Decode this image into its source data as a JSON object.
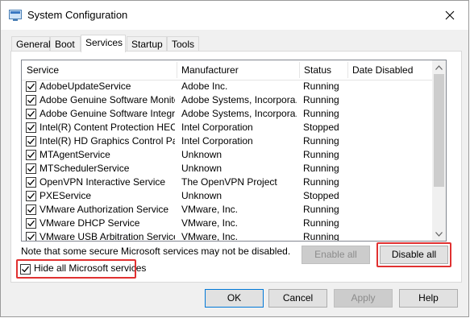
{
  "window": {
    "title": "System Configuration"
  },
  "tabs": [
    {
      "label": "General"
    },
    {
      "label": "Boot"
    },
    {
      "label": "Services",
      "active": true
    },
    {
      "label": "Startup"
    },
    {
      "label": "Tools"
    }
  ],
  "list": {
    "columns": [
      "Service",
      "Manufacturer",
      "Status",
      "Date Disabled"
    ],
    "rows": [
      {
        "checked": true,
        "service": "AdobeUpdateService",
        "manufacturer": "Adobe Inc.",
        "status": "Running"
      },
      {
        "checked": true,
        "service": "Adobe Genuine Software Monito...",
        "manufacturer": "Adobe Systems, Incorpora...",
        "status": "Running"
      },
      {
        "checked": true,
        "service": "Adobe Genuine Software Integri...",
        "manufacturer": "Adobe Systems, Incorpora...",
        "status": "Running"
      },
      {
        "checked": true,
        "service": "Intel(R) Content Protection HEC...",
        "manufacturer": "Intel Corporation",
        "status": "Stopped"
      },
      {
        "checked": true,
        "service": "Intel(R) HD Graphics Control Pa...",
        "manufacturer": "Intel Corporation",
        "status": "Running"
      },
      {
        "checked": true,
        "service": "MTAgentService",
        "manufacturer": "Unknown",
        "status": "Running"
      },
      {
        "checked": true,
        "service": "MTSchedulerService",
        "manufacturer": "Unknown",
        "status": "Running"
      },
      {
        "checked": true,
        "service": "OpenVPN Interactive Service",
        "manufacturer": "The OpenVPN Project",
        "status": "Running"
      },
      {
        "checked": true,
        "service": "PXEService",
        "manufacturer": "Unknown",
        "status": "Stopped"
      },
      {
        "checked": true,
        "service": "VMware Authorization Service",
        "manufacturer": "VMware, Inc.",
        "status": "Running"
      },
      {
        "checked": true,
        "service": "VMware DHCP Service",
        "manufacturer": "VMware, Inc.",
        "status": "Running"
      },
      {
        "checked": true,
        "service": "VMware USB Arbitration Service",
        "manufacturer": "VMware, Inc.",
        "status": "Running"
      }
    ]
  },
  "note": "Note that some secure Microsoft services may not be disabled.",
  "buttons": {
    "enable_all": "Enable all",
    "disable_all": "Disable all",
    "ok": "OK",
    "cancel": "Cancel",
    "apply": "Apply",
    "help": "Help"
  },
  "hide_ms": {
    "label": "Hide all Microsoft services",
    "checked": true
  },
  "colors": {
    "highlight": "#e03131"
  }
}
